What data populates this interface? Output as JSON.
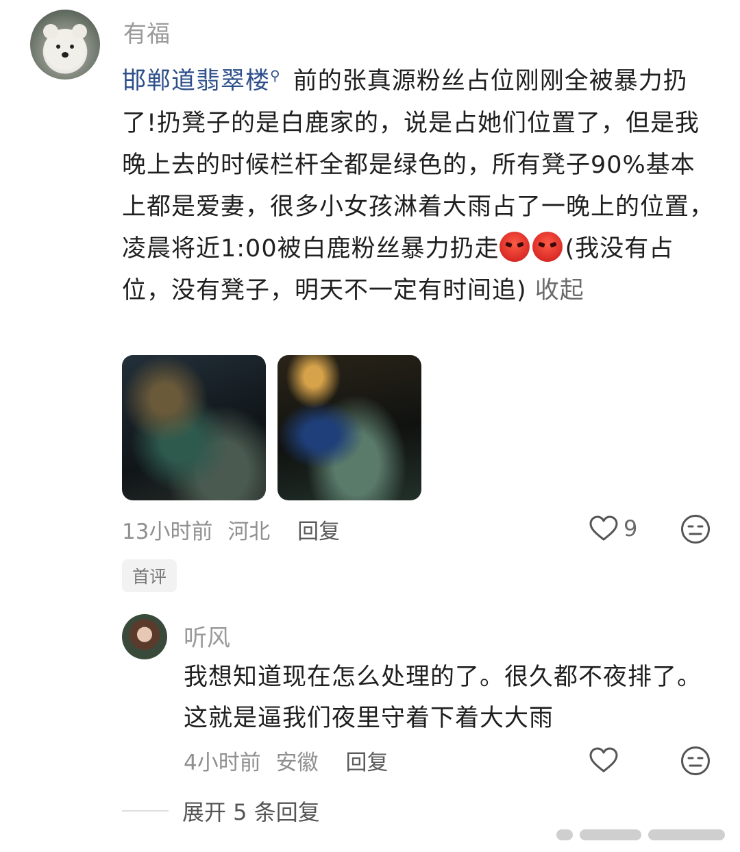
{
  "main_comment": {
    "username": "有福",
    "mention": "邯郸道翡翠楼",
    "body_after_mention": " 前的张真源粉丝占位刚刚全被暴力扔了!扔凳子的是白鹿家的，说是占她们位置了，但是我晚上去的时候栏杆全都是绿色的，所有凳子90%基本上都是爱妻，很多小女孩淋着大雨占了一晚上的位置，凌晨将近1:00被白鹿粉丝暴力扔走",
    "body_after_emoji": "(我没有占位，没有凳子，明天不一定有时间追) ",
    "collapse_label": "收起",
    "time": "13小时前",
    "location": "河北",
    "reply_label": "回复",
    "like_count": "9",
    "badge": "首评"
  },
  "reply": {
    "username": "听风",
    "body": "我想知道现在怎么处理的了。很久都不夜排了。这就是逼我们夜里守着下着大大雨",
    "time": "4小时前",
    "location": "安徽",
    "reply_label": "回复"
  },
  "expand": {
    "label": "展开 5 条回复"
  },
  "icons": {
    "like": "heart-outline-icon",
    "meh": "expressionless-face-icon",
    "emoji": "angry-face-emoji"
  },
  "colors": {
    "link": "#2d4f8a",
    "meta": "#8f8f8f",
    "emoji": "#d8251e"
  }
}
